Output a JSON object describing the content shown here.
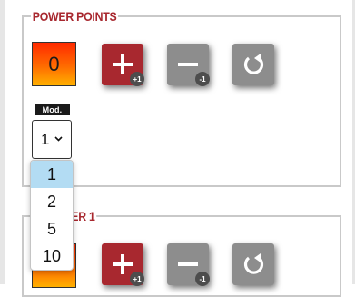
{
  "sections": [
    {
      "legend": "POWER POINTS",
      "counter_value": "0",
      "buttons": {
        "plus_badge": "+1",
        "minus_badge": "-1"
      },
      "mod_label": "Mod.",
      "select_value": "1"
    },
    {
      "legend": "COUNTER 1",
      "buttons": {
        "plus_badge": "+1",
        "minus_badge": "-1"
      }
    }
  ],
  "dropdown": {
    "options": [
      "1",
      "2",
      "5",
      "10"
    ],
    "selected": "1"
  },
  "icons": {
    "plus": "plus-icon",
    "minus": "minus-icon",
    "reset": "reset-icon",
    "chevron": "chevron-down-icon"
  },
  "colors": {
    "accent_red": "#a8282f",
    "button_gray": "#8d8d8d",
    "option_highlight": "#b3dcf3"
  }
}
